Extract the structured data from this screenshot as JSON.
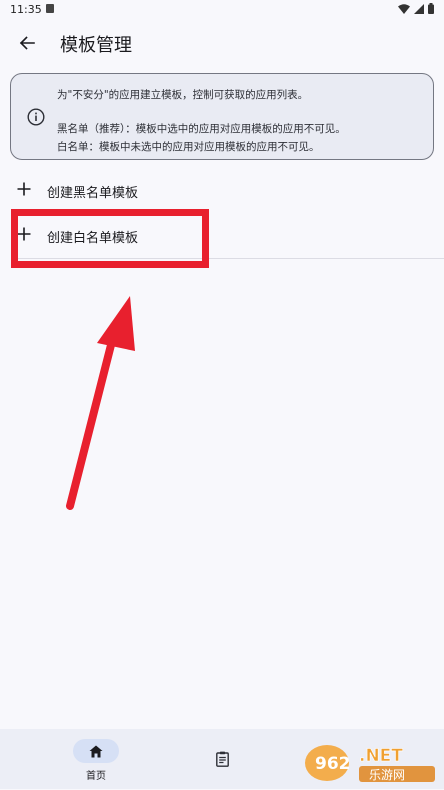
{
  "status_bar": {
    "time": "11:35"
  },
  "app_bar": {
    "title": "模板管理",
    "back_icon": "arrow-back-icon"
  },
  "info_card": {
    "icon": "info-icon",
    "line1": "为\"不安分\"的应用建立模板，控制可获取的应用列表。",
    "line2": "黑名单（推荐）：模板中选中的应用对应用模板的应用不可见。",
    "line3": "白名单：模板中未选中的应用对应用模板的应用不可见。"
  },
  "actions": [
    {
      "icon": "plus-icon",
      "label": "创建黑名单模板"
    },
    {
      "icon": "plus-icon",
      "label": "创建白名单模板"
    }
  ],
  "bottom_nav": {
    "items": [
      {
        "icon": "home-icon",
        "label": "首页",
        "selected": true
      },
      {
        "icon": "clipboard-icon",
        "label": "",
        "selected": false
      }
    ]
  },
  "watermark": {
    "text": "962.NET 乐游网"
  },
  "colors": {
    "annotation_red": "#e8202e",
    "background": "#f8f8fc",
    "card": "#e9ebf3",
    "nav_pill": "#d6e0f5"
  }
}
